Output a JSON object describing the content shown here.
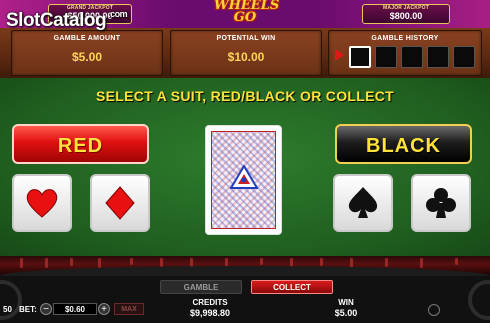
{
  "header": {
    "grand_jackpot_label": "GRAND JACKPOT",
    "grand_jackpot_value": "$50,000.00",
    "logo_text": "WHEELS GO",
    "major_jackpot_label": "MAJOR JACKPOT",
    "major_jackpot_value": "$800.00"
  },
  "watermark": {
    "text": "SlotCatalog",
    "suffix": ".com"
  },
  "info": {
    "gamble_amount_label": "GAMBLE AMOUNT",
    "gamble_amount_value": "$5.00",
    "potential_win_label": "POTENTIAL WIN",
    "potential_win_value": "$10.00",
    "gamble_history_label": "GAMBLE HISTORY",
    "history_slots": [
      "",
      "",
      "",
      "",
      ""
    ]
  },
  "prompt": "SELECT A SUIT, RED/BLACK OR COLLECT",
  "buttons": {
    "red": "RED",
    "black": "BLACK"
  },
  "suits": {
    "red": [
      "heart",
      "diamond"
    ],
    "black": [
      "spade",
      "club"
    ]
  },
  "bottom": {
    "gamble_tab": "GAMBLE",
    "collect_tab": "COLLECT",
    "credits_label": "CREDITS",
    "credits_value": "$9,998.80",
    "win_label": "WIN",
    "win_value": "$5.00",
    "lines": "50",
    "bet_label": "BET:",
    "bet_value": "$0.60",
    "max_label": "MAX",
    "minus": "−",
    "plus": "+"
  },
  "colors": {
    "felt": "#2e7d2e",
    "accent_yellow": "#ffe23a",
    "red_button": "#e01010",
    "black_button": "#1e1e1e"
  }
}
